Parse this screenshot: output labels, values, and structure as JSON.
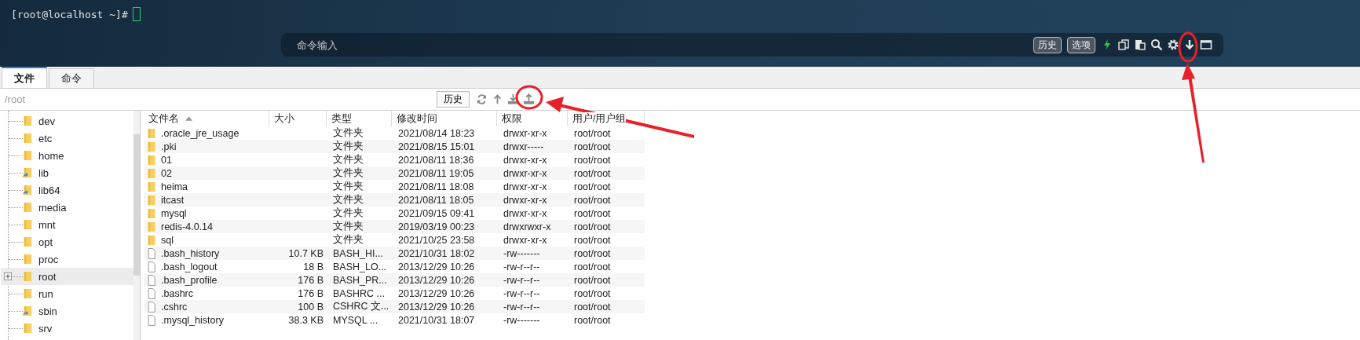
{
  "terminal": {
    "prompt": "[root@localhost ~]#"
  },
  "command_bar": {
    "placeholder": "命令输入",
    "buttons": [
      "历史",
      "选项"
    ]
  },
  "tabs": [
    {
      "label": "文件",
      "selected": true
    },
    {
      "label": "命令",
      "selected": false
    }
  ],
  "path_bar": {
    "path": "/root",
    "history_button": "历史"
  },
  "tree": {
    "items": [
      {
        "name": "dev",
        "link": false,
        "expandable": false,
        "selected": false
      },
      {
        "name": "etc",
        "link": false,
        "expandable": false,
        "selected": false
      },
      {
        "name": "home",
        "link": false,
        "expandable": false,
        "selected": false
      },
      {
        "name": "lib",
        "link": true,
        "expandable": false,
        "selected": false
      },
      {
        "name": "lib64",
        "link": true,
        "expandable": false,
        "selected": false
      },
      {
        "name": "media",
        "link": false,
        "expandable": false,
        "selected": false
      },
      {
        "name": "mnt",
        "link": false,
        "expandable": false,
        "selected": false
      },
      {
        "name": "opt",
        "link": false,
        "expandable": false,
        "selected": false
      },
      {
        "name": "proc",
        "link": false,
        "expandable": false,
        "selected": false
      },
      {
        "name": "root",
        "link": false,
        "expandable": true,
        "selected": true
      },
      {
        "name": "run",
        "link": false,
        "expandable": false,
        "selected": false
      },
      {
        "name": "sbin",
        "link": true,
        "expandable": false,
        "selected": false
      },
      {
        "name": "srv",
        "link": false,
        "expandable": false,
        "selected": false
      }
    ]
  },
  "file_table": {
    "columns": [
      {
        "label": "文件名",
        "sorted": true
      },
      {
        "label": "大小",
        "sorted": false
      },
      {
        "label": "类型",
        "sorted": false
      },
      {
        "label": "修改时间",
        "sorted": false
      },
      {
        "label": "权限",
        "sorted": false
      },
      {
        "label": "用户/用户组",
        "sorted": false
      }
    ],
    "rows": [
      {
        "kind": "folder",
        "name": ".oracle_jre_usage",
        "type": "文件夹",
        "modified": "2021/08/14 18:23",
        "permissions": "drwxr-xr-x",
        "owner": "root/root"
      },
      {
        "kind": "folder",
        "name": ".pki",
        "type": "文件夹",
        "modified": "2021/08/15 15:01",
        "permissions": "drwxr-----",
        "owner": "root/root"
      },
      {
        "kind": "folder",
        "name": "01",
        "type": "文件夹",
        "modified": "2021/08/11 18:36",
        "permissions": "drwxr-xr-x",
        "owner": "root/root"
      },
      {
        "kind": "folder",
        "name": "02",
        "type": "文件夹",
        "modified": "2021/08/11 19:05",
        "permissions": "drwxr-xr-x",
        "owner": "root/root"
      },
      {
        "kind": "folder",
        "name": "heima",
        "type": "文件夹",
        "modified": "2021/08/11 18:08",
        "permissions": "drwxr-xr-x",
        "owner": "root/root"
      },
      {
        "kind": "folder",
        "name": "itcast",
        "type": "文件夹",
        "modified": "2021/08/11 18:05",
        "permissions": "drwxr-xr-x",
        "owner": "root/root"
      },
      {
        "kind": "folder",
        "name": "mysql",
        "type": "文件夹",
        "modified": "2021/09/15 09:41",
        "permissions": "drwxr-xr-x",
        "owner": "root/root"
      },
      {
        "kind": "folder",
        "name": "redis-4.0.14",
        "type": "文件夹",
        "modified": "2019/03/19 00:23",
        "permissions": "drwxrwxr-x",
        "owner": "root/root"
      },
      {
        "kind": "folder",
        "name": "sql",
        "type": "文件夹",
        "modified": "2021/10/25 23:58",
        "permissions": "drwxr-xr-x",
        "owner": "root/root"
      },
      {
        "kind": "file",
        "name": ".bash_history",
        "size": "10.7 KB",
        "type": "BASH_HI...",
        "modified": "2021/10/31 18:02",
        "permissions": "-rw-------",
        "owner": "root/root"
      },
      {
        "kind": "file",
        "name": ".bash_logout",
        "size": "18 B",
        "type": "BASH_LO...",
        "modified": "2013/12/29 10:26",
        "permissions": "-rw-r--r--",
        "owner": "root/root"
      },
      {
        "kind": "file",
        "name": ".bash_profile",
        "size": "176 B",
        "type": "BASH_PR...",
        "modified": "2013/12/29 10:26",
        "permissions": "-rw-r--r--",
        "owner": "root/root"
      },
      {
        "kind": "file",
        "name": ".bashrc",
        "size": "176 B",
        "type": "BASHRC ...",
        "modified": "2013/12/29 10:26",
        "permissions": "-rw-r--r--",
        "owner": "root/root"
      },
      {
        "kind": "file",
        "name": ".cshrc",
        "size": "100 B",
        "type": "CSHRC 文...",
        "modified": "2013/12/29 10:26",
        "permissions": "-rw-r--r--",
        "owner": "root/root"
      },
      {
        "kind": "file",
        "name": ".mysql_history",
        "size": "38.3 KB",
        "type": "MYSQL ...",
        "modified": "2021/10/31 18:07",
        "permissions": "-rw-------",
        "owner": "root/root"
      }
    ]
  }
}
